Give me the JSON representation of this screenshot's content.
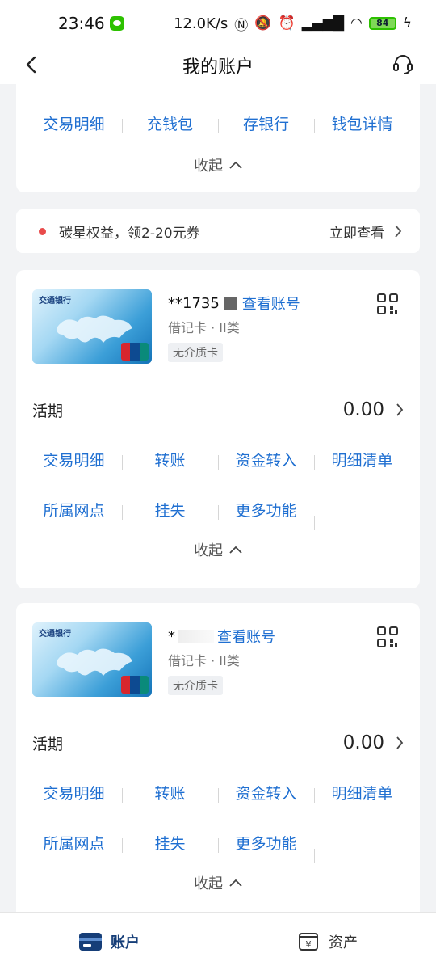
{
  "status_bar": {
    "time": "23:46",
    "speed": "12.0K/s",
    "battery": "84"
  },
  "header": {
    "title": "我的账户"
  },
  "wallet_card": {
    "actions": [
      "交易明细",
      "充钱包",
      "存银行",
      "钱包详情"
    ],
    "collapse": "收起"
  },
  "promo": {
    "text": "碳星权益，领2-20元券",
    "link": "立即查看"
  },
  "accounts": [
    {
      "masked_no": "**1735",
      "view_label": "查看账号",
      "card_type": "借记卡 · II类",
      "tag": "无介质卡",
      "balance_label": "活期",
      "balance": "0.00",
      "row1": [
        "交易明细",
        "转账",
        "资金转入",
        "明细清单"
      ],
      "row2": [
        "所属网点",
        "挂失",
        "更多功能"
      ],
      "collapse": "收起"
    },
    {
      "masked_no": "*",
      "view_label": "查看账号",
      "card_type": "借记卡 · II类",
      "tag": "无介质卡",
      "balance_label": "活期",
      "balance": "0.00",
      "row1": [
        "交易明细",
        "转账",
        "资金转入",
        "明细清单"
      ],
      "row2": [
        "所属网点",
        "挂失",
        "更多功能"
      ],
      "collapse": "收起"
    }
  ],
  "bank_card_art": {
    "bank_name": "交通银行",
    "brand": "UnionPay 银联"
  },
  "tabbar": {
    "accounts": "账户",
    "assets": "资产"
  },
  "colors": {
    "link_blue": "#1f6fd1",
    "brand_navy": "#163e78",
    "background": "#f2f3f5"
  }
}
